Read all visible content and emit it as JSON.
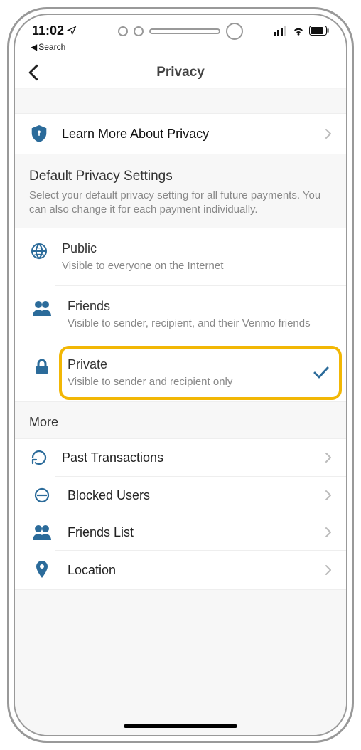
{
  "status": {
    "time": "11:02",
    "back_search": "Search"
  },
  "nav": {
    "title": "Privacy"
  },
  "learn_more": {
    "label": "Learn More About Privacy"
  },
  "default_section": {
    "title": "Default Privacy Settings",
    "desc": "Select your default privacy setting for all future payments. You can also change it for each payment individually.",
    "options": [
      {
        "title": "Public",
        "desc": "Visible to everyone on the Internet"
      },
      {
        "title": "Friends",
        "desc": "Visible to sender, recipient, and their Venmo friends"
      },
      {
        "title": "Private",
        "desc": "Visible to sender and recipient only",
        "selected": true,
        "highlighted": true
      }
    ]
  },
  "more_section": {
    "title": "More",
    "items": [
      {
        "label": "Past Transactions"
      },
      {
        "label": "Blocked Users"
      },
      {
        "label": "Friends List"
      },
      {
        "label": "Location"
      }
    ]
  }
}
